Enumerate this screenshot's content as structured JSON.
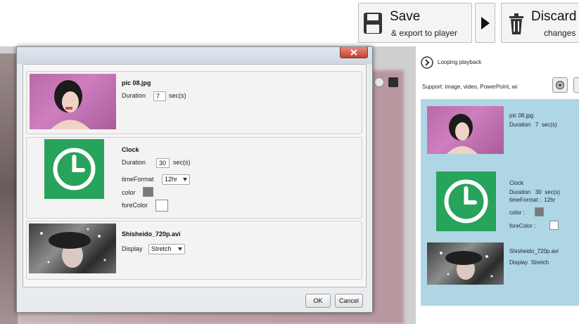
{
  "toolbar": {
    "save": {
      "title": "Save",
      "subtitle": "& export to player"
    },
    "discard": {
      "title": "Discard",
      "subtitle": "changes"
    }
  },
  "right_panel": {
    "looping_label": "Looping playback",
    "support_label": "Support:  image, video, PowerPoint, wi",
    "items": [
      {
        "name": "pic 08.jpg",
        "duration_label": "Duration",
        "duration_value": "7",
        "duration_unit": "sec(s)"
      },
      {
        "name": "Clock",
        "duration_label": "Duration",
        "duration_value": "30",
        "duration_unit": "sec(s)",
        "timeformat_label": "timeFormat :",
        "timeformat_value": "12hr",
        "color_label": "color :",
        "forecolor_label": "foreColor :"
      },
      {
        "name": "Shisheido_720p.avi",
        "display_label": "Display",
        "display_value": "Stretch"
      }
    ]
  },
  "dialog": {
    "items": [
      {
        "name": "pic 08.jpg",
        "duration_label": "Duration",
        "duration_value": "7",
        "duration_unit": "sec(s)"
      },
      {
        "name": "Clock",
        "duration_label": "Duration",
        "duration_value": "30",
        "duration_unit": "sec(s)",
        "timeformat_label": "timeFormat",
        "timeformat_value": "12hr",
        "color_label": "color",
        "forecolor_label": "foreColor"
      },
      {
        "name": "Shisheido_720p.avi",
        "display_label": "Display",
        "display_value": "Stretch"
      }
    ],
    "ok_label": "OK",
    "cancel_label": "Cancel"
  },
  "colors": {
    "clock_green": "#27a35b",
    "panel_blue": "#aed6e4",
    "color_swatch": "#7a7a7a",
    "forecolor_swatch": "#ffffff",
    "close_red": "#cf4a3c"
  },
  "icons": [
    "floppy-disk-icon",
    "play-arrow-icon",
    "trash-icon",
    "window-close-icon",
    "loop-play-icon",
    "settings-icon",
    "clock-icon",
    "dropdown-arrow-icon"
  ]
}
